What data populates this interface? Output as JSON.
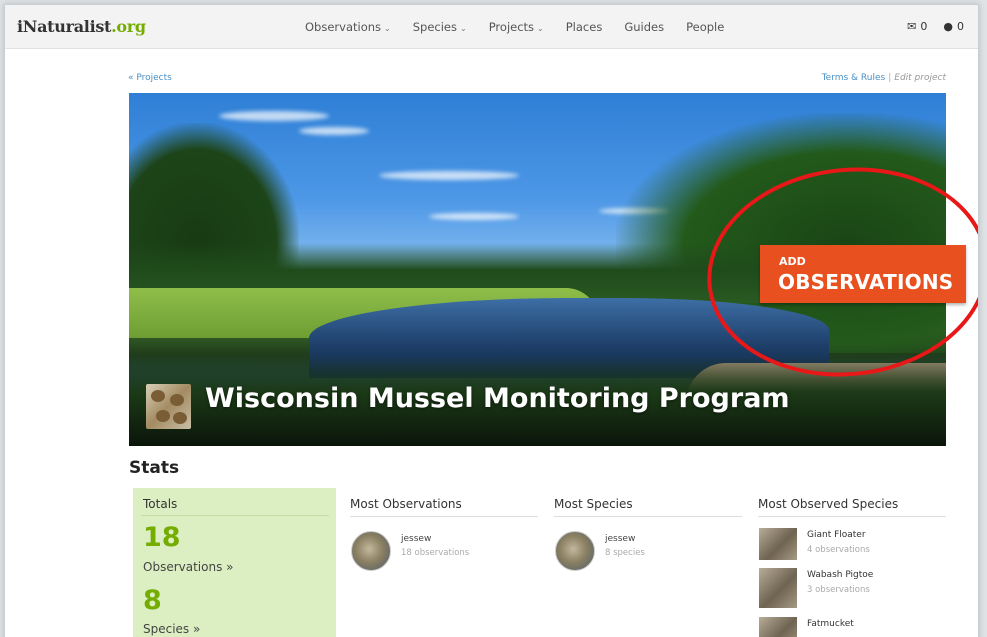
{
  "logo": {
    "name": "iNaturalist",
    "tld": ".org"
  },
  "nav": {
    "items": [
      {
        "label": "Observations",
        "dropdown": true
      },
      {
        "label": "Species",
        "dropdown": true
      },
      {
        "label": "Projects",
        "dropdown": true
      },
      {
        "label": "Places",
        "dropdown": false
      },
      {
        "label": "Guides",
        "dropdown": false
      },
      {
        "label": "People",
        "dropdown": false
      }
    ],
    "messages_count": "0",
    "notifications_count": "0"
  },
  "breadcrumb": {
    "back_label": "« Projects"
  },
  "project_links": {
    "terms": "Terms & Rules",
    "separator": "|",
    "edit": "Edit project"
  },
  "banner": {
    "title": "Wisconsin Mussel Monitoring Program",
    "add_small": "ADD",
    "add_big": "OBSERVATIONS"
  },
  "stats": {
    "heading": "Stats",
    "totals": {
      "label": "Totals",
      "observations_count": "18",
      "observations_label": "Observations »",
      "species_count": "8",
      "species_label": "Species »"
    },
    "most_observations": {
      "heading": "Most Observations",
      "user": "jessew",
      "count_text": "18 observations"
    },
    "most_species": {
      "heading": "Most Species",
      "user": "jessew",
      "count_text": "8 species"
    },
    "most_observed_species": {
      "heading": "Most Observed Species",
      "items": [
        {
          "name": "Giant Floater",
          "count_text": "4 observations"
        },
        {
          "name": "Wabash Pigtoe",
          "count_text": "3 observations"
        },
        {
          "name": "Fatmucket",
          "count_text": ""
        }
      ]
    }
  },
  "colors": {
    "brand_green": "#74ac00",
    "add_button": "#e8501f",
    "highlight_circle": "#e81818",
    "link": "#4a8fc4"
  }
}
